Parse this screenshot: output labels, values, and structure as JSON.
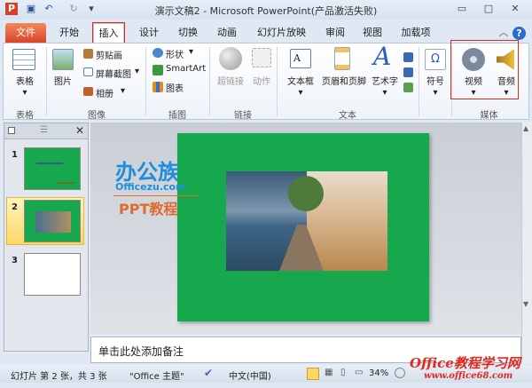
{
  "window": {
    "title": "演示文稿2 - Microsoft PowerPoint(产品激活失败)"
  },
  "tabs": [
    "文件",
    "开始",
    "插入",
    "设计",
    "切换",
    "动画",
    "幻灯片放映",
    "审阅",
    "视图",
    "加载项"
  ],
  "ribbon": {
    "groups": {
      "table": "表格",
      "images": "图像",
      "illustrations": "插图",
      "links": "链接",
      "text": "文本",
      "media": "媒体"
    },
    "buttons": {
      "table": "表格",
      "picture": "图片",
      "clipart": "剪贴画",
      "screenshot": "屏幕截图",
      "album": "相册",
      "shapes": "形状",
      "smartart": "SmartArt",
      "chart": "图表",
      "hyperlink": "超链接",
      "action": "动作",
      "textbox": "文本框",
      "header_footer": "页眉和页脚",
      "wordart": "艺术字",
      "symbol": "符号",
      "video": "视频",
      "audio": "音频"
    }
  },
  "slides": [
    {
      "number": "1"
    },
    {
      "number": "2"
    },
    {
      "number": "3"
    }
  ],
  "notes": {
    "placeholder": "单击此处添加备注"
  },
  "status": {
    "slide_info": "幻灯片 第 2 张，共 3 张",
    "theme": "\"Office 主题\"",
    "language": "中文(中国)",
    "zoom": "34%"
  },
  "watermark": {
    "logo1": "办公族",
    "logo1_url": "Officezu.com",
    "logo1_sub": "PPT教程",
    "logo2": "Office教程学习网",
    "logo2_url": "www.office68.com"
  },
  "colors": {
    "slide_bg": "#17a84d",
    "file_tab": "#d8452a",
    "highlight": "#e0281f"
  }
}
